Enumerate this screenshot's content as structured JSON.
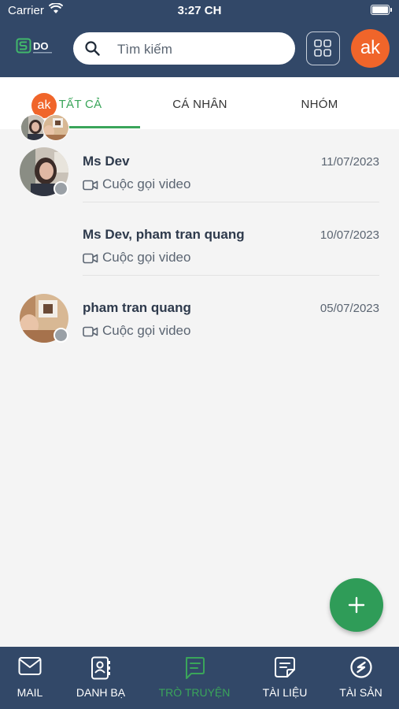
{
  "status_bar": {
    "carrier": "Carrier",
    "time": "3:27 CH"
  },
  "header": {
    "logo_text": "DO",
    "search_placeholder": "Tìm kiếm",
    "user_initials": "ak"
  },
  "tabs": [
    {
      "label": "TẤT CẢ",
      "active": true
    },
    {
      "label": "CÁ NHÂN",
      "active": false
    },
    {
      "label": "NHÓM",
      "active": false
    }
  ],
  "conversations": [
    {
      "name": "Ms Dev",
      "date": "11/07/2023",
      "last_message": "Cuộc gọi video",
      "type": "single"
    },
    {
      "name": "Ms Dev, pham tran quang",
      "date": "10/07/2023",
      "last_message": "Cuộc gọi video",
      "type": "group",
      "group_initials": "ak"
    },
    {
      "name": "pham tran quang",
      "date": "05/07/2023",
      "last_message": "Cuộc gọi video",
      "type": "single"
    }
  ],
  "bottom_nav": [
    {
      "label": "MAIL",
      "icon": "mail-icon",
      "active": false
    },
    {
      "label": "DANH BẠ",
      "icon": "contacts-icon",
      "active": false
    },
    {
      "label": "TRÒ TRUYỆN",
      "icon": "chat-icon",
      "active": true
    },
    {
      "label": "TÀI LIỆU",
      "icon": "document-icon",
      "active": false
    },
    {
      "label": "TÀI SẢN",
      "icon": "asset-icon",
      "active": false
    }
  ],
  "colors": {
    "header_bg": "#324868",
    "accent_green": "#3aa55a",
    "fab_green": "#2f9c58",
    "avatar_orange": "#f0652a"
  }
}
